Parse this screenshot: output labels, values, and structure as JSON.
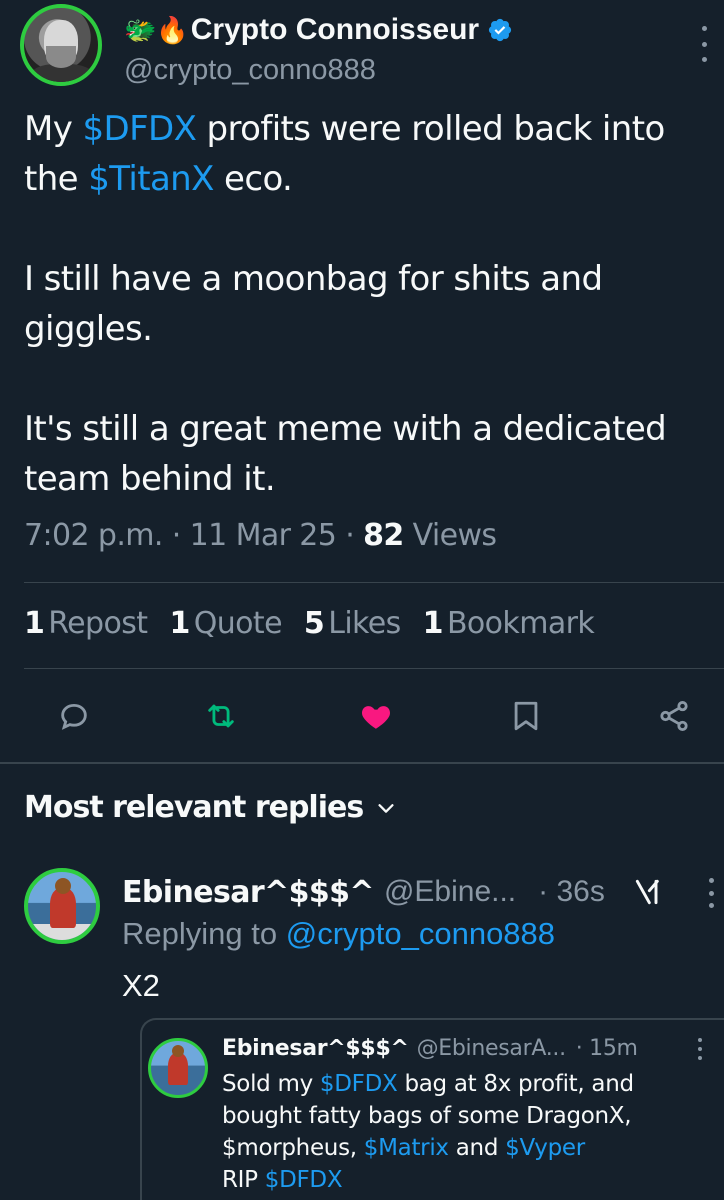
{
  "author": {
    "emojis": "🐲🔥",
    "display_name": "Crypto Connoisseur",
    "handle": "@crypto_conno888"
  },
  "tweet": {
    "p1_a": "My ",
    "p1_tag1": "$DFDX",
    "p1_b": " profits were rolled back into the ",
    "p1_tag2": "$TitanX",
    "p1_c": " eco.",
    "p2": "I still have a moonbag for shits and giggles.",
    "p3": "It's still a great meme with a dedicated team behind it."
  },
  "meta": {
    "time": "7:02 p.m.",
    "sep1": " · ",
    "date": "11 Mar 25",
    "sep2": " · ",
    "views_count": "82",
    "views_label": " Views"
  },
  "stats": [
    {
      "count": "1",
      "label": "Repost"
    },
    {
      "count": "1",
      "label": "Quote"
    },
    {
      "count": "5",
      "label": "Likes"
    },
    {
      "count": "1",
      "label": "Bookmark"
    }
  ],
  "actions": {
    "reply_icon": "reply-icon",
    "repost_icon": "repost-icon",
    "like_icon": "heart-icon",
    "bookmark_icon": "bookmark-icon",
    "share_icon": "share-icon"
  },
  "colors": {
    "background": "#15202b",
    "accent": "#1d9bf0",
    "repost": "#00ba7c",
    "like": "#f91880",
    "avatar_ring": "#2ecc40"
  },
  "replies_header": "Most relevant replies",
  "reply": {
    "name": "Ebinesar^$$$^",
    "handle": "@Ebine...",
    "time": "· 36s",
    "replying_prefix": "Replying to ",
    "replying_handle": "@crypto_conno888",
    "text": "X2"
  },
  "quoted": {
    "name": "Ebinesar^$$$^",
    "handle": "@EbinesarA...",
    "time": "· 15m",
    "l1_a": "Sold my ",
    "l1_tag": "$DFDX",
    "l1_b": " bag at 8x profit, and",
    "l2": "bought fatty bags of some DragonX,",
    "l3_a": "$morpheus, ",
    "l3_tag1": "$Matrix",
    "l3_b": " and ",
    "l3_tag2": "$Vyper",
    "l4_a": "RIP ",
    "l4_tag": "$DFDX"
  }
}
